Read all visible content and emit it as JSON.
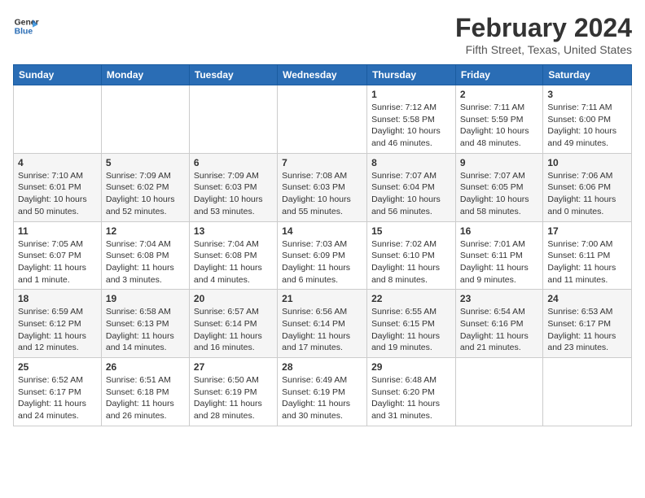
{
  "header": {
    "logo_general": "General",
    "logo_blue": "Blue",
    "month": "February 2024",
    "location": "Fifth Street, Texas, United States"
  },
  "days_of_week": [
    "Sunday",
    "Monday",
    "Tuesday",
    "Wednesday",
    "Thursday",
    "Friday",
    "Saturday"
  ],
  "weeks": [
    [
      {
        "day": "",
        "sunrise": "",
        "sunset": "",
        "daylight": ""
      },
      {
        "day": "",
        "sunrise": "",
        "sunset": "",
        "daylight": ""
      },
      {
        "day": "",
        "sunrise": "",
        "sunset": "",
        "daylight": ""
      },
      {
        "day": "",
        "sunrise": "",
        "sunset": "",
        "daylight": ""
      },
      {
        "day": "1",
        "sunrise": "Sunrise: 7:12 AM",
        "sunset": "Sunset: 5:58 PM",
        "daylight": "Daylight: 10 hours and 46 minutes."
      },
      {
        "day": "2",
        "sunrise": "Sunrise: 7:11 AM",
        "sunset": "Sunset: 5:59 PM",
        "daylight": "Daylight: 10 hours and 48 minutes."
      },
      {
        "day": "3",
        "sunrise": "Sunrise: 7:11 AM",
        "sunset": "Sunset: 6:00 PM",
        "daylight": "Daylight: 10 hours and 49 minutes."
      }
    ],
    [
      {
        "day": "4",
        "sunrise": "Sunrise: 7:10 AM",
        "sunset": "Sunset: 6:01 PM",
        "daylight": "Daylight: 10 hours and 50 minutes."
      },
      {
        "day": "5",
        "sunrise": "Sunrise: 7:09 AM",
        "sunset": "Sunset: 6:02 PM",
        "daylight": "Daylight: 10 hours and 52 minutes."
      },
      {
        "day": "6",
        "sunrise": "Sunrise: 7:09 AM",
        "sunset": "Sunset: 6:03 PM",
        "daylight": "Daylight: 10 hours and 53 minutes."
      },
      {
        "day": "7",
        "sunrise": "Sunrise: 7:08 AM",
        "sunset": "Sunset: 6:03 PM",
        "daylight": "Daylight: 10 hours and 55 minutes."
      },
      {
        "day": "8",
        "sunrise": "Sunrise: 7:07 AM",
        "sunset": "Sunset: 6:04 PM",
        "daylight": "Daylight: 10 hours and 56 minutes."
      },
      {
        "day": "9",
        "sunrise": "Sunrise: 7:07 AM",
        "sunset": "Sunset: 6:05 PM",
        "daylight": "Daylight: 10 hours and 58 minutes."
      },
      {
        "day": "10",
        "sunrise": "Sunrise: 7:06 AM",
        "sunset": "Sunset: 6:06 PM",
        "daylight": "Daylight: 11 hours and 0 minutes."
      }
    ],
    [
      {
        "day": "11",
        "sunrise": "Sunrise: 7:05 AM",
        "sunset": "Sunset: 6:07 PM",
        "daylight": "Daylight: 11 hours and 1 minute."
      },
      {
        "day": "12",
        "sunrise": "Sunrise: 7:04 AM",
        "sunset": "Sunset: 6:08 PM",
        "daylight": "Daylight: 11 hours and 3 minutes."
      },
      {
        "day": "13",
        "sunrise": "Sunrise: 7:04 AM",
        "sunset": "Sunset: 6:08 PM",
        "daylight": "Daylight: 11 hours and 4 minutes."
      },
      {
        "day": "14",
        "sunrise": "Sunrise: 7:03 AM",
        "sunset": "Sunset: 6:09 PM",
        "daylight": "Daylight: 11 hours and 6 minutes."
      },
      {
        "day": "15",
        "sunrise": "Sunrise: 7:02 AM",
        "sunset": "Sunset: 6:10 PM",
        "daylight": "Daylight: 11 hours and 8 minutes."
      },
      {
        "day": "16",
        "sunrise": "Sunrise: 7:01 AM",
        "sunset": "Sunset: 6:11 PM",
        "daylight": "Daylight: 11 hours and 9 minutes."
      },
      {
        "day": "17",
        "sunrise": "Sunrise: 7:00 AM",
        "sunset": "Sunset: 6:11 PM",
        "daylight": "Daylight: 11 hours and 11 minutes."
      }
    ],
    [
      {
        "day": "18",
        "sunrise": "Sunrise: 6:59 AM",
        "sunset": "Sunset: 6:12 PM",
        "daylight": "Daylight: 11 hours and 12 minutes."
      },
      {
        "day": "19",
        "sunrise": "Sunrise: 6:58 AM",
        "sunset": "Sunset: 6:13 PM",
        "daylight": "Daylight: 11 hours and 14 minutes."
      },
      {
        "day": "20",
        "sunrise": "Sunrise: 6:57 AM",
        "sunset": "Sunset: 6:14 PM",
        "daylight": "Daylight: 11 hours and 16 minutes."
      },
      {
        "day": "21",
        "sunrise": "Sunrise: 6:56 AM",
        "sunset": "Sunset: 6:14 PM",
        "daylight": "Daylight: 11 hours and 17 minutes."
      },
      {
        "day": "22",
        "sunrise": "Sunrise: 6:55 AM",
        "sunset": "Sunset: 6:15 PM",
        "daylight": "Daylight: 11 hours and 19 minutes."
      },
      {
        "day": "23",
        "sunrise": "Sunrise: 6:54 AM",
        "sunset": "Sunset: 6:16 PM",
        "daylight": "Daylight: 11 hours and 21 minutes."
      },
      {
        "day": "24",
        "sunrise": "Sunrise: 6:53 AM",
        "sunset": "Sunset: 6:17 PM",
        "daylight": "Daylight: 11 hours and 23 minutes."
      }
    ],
    [
      {
        "day": "25",
        "sunrise": "Sunrise: 6:52 AM",
        "sunset": "Sunset: 6:17 PM",
        "daylight": "Daylight: 11 hours and 24 minutes."
      },
      {
        "day": "26",
        "sunrise": "Sunrise: 6:51 AM",
        "sunset": "Sunset: 6:18 PM",
        "daylight": "Daylight: 11 hours and 26 minutes."
      },
      {
        "day": "27",
        "sunrise": "Sunrise: 6:50 AM",
        "sunset": "Sunset: 6:19 PM",
        "daylight": "Daylight: 11 hours and 28 minutes."
      },
      {
        "day": "28",
        "sunrise": "Sunrise: 6:49 AM",
        "sunset": "Sunset: 6:19 PM",
        "daylight": "Daylight: 11 hours and 30 minutes."
      },
      {
        "day": "29",
        "sunrise": "Sunrise: 6:48 AM",
        "sunset": "Sunset: 6:20 PM",
        "daylight": "Daylight: 11 hours and 31 minutes."
      },
      {
        "day": "",
        "sunrise": "",
        "sunset": "",
        "daylight": ""
      },
      {
        "day": "",
        "sunrise": "",
        "sunset": "",
        "daylight": ""
      }
    ]
  ]
}
